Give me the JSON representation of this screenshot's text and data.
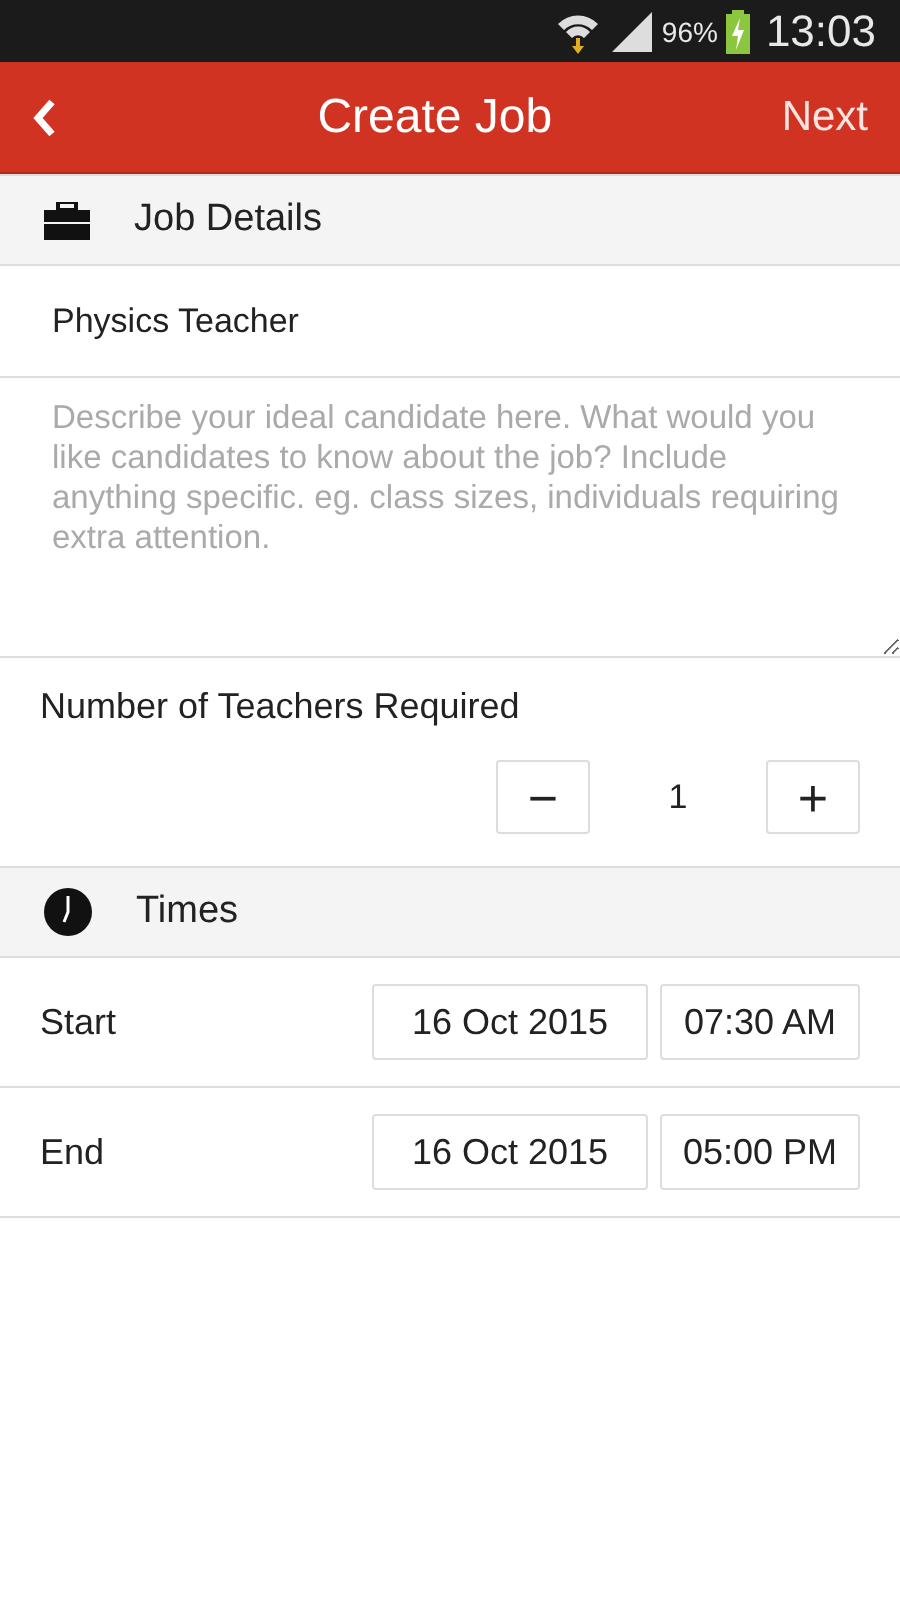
{
  "status_bar": {
    "battery": "96%",
    "time": "13:03"
  },
  "app_bar": {
    "title": "Create Job",
    "action": "Next"
  },
  "job_details": {
    "header": "Job Details",
    "title_field": {
      "value": "Physics Teacher"
    },
    "description_field": {
      "placeholder": "Describe your ideal candidate here. What would you like candidates to know about the job? Include anything specific. eg. class sizes, individuals requiring extra attention."
    },
    "teachers": {
      "label": "Number of Teachers Required",
      "decrement": "−",
      "count": "1",
      "increment": "+"
    }
  },
  "times": {
    "header": "Times",
    "rows": [
      {
        "label": "Start",
        "date": "16 Oct 2015",
        "time": "07:30 AM"
      },
      {
        "label": "End",
        "date": "16 Oct 2015",
        "time": "05:00 PM"
      }
    ]
  }
}
